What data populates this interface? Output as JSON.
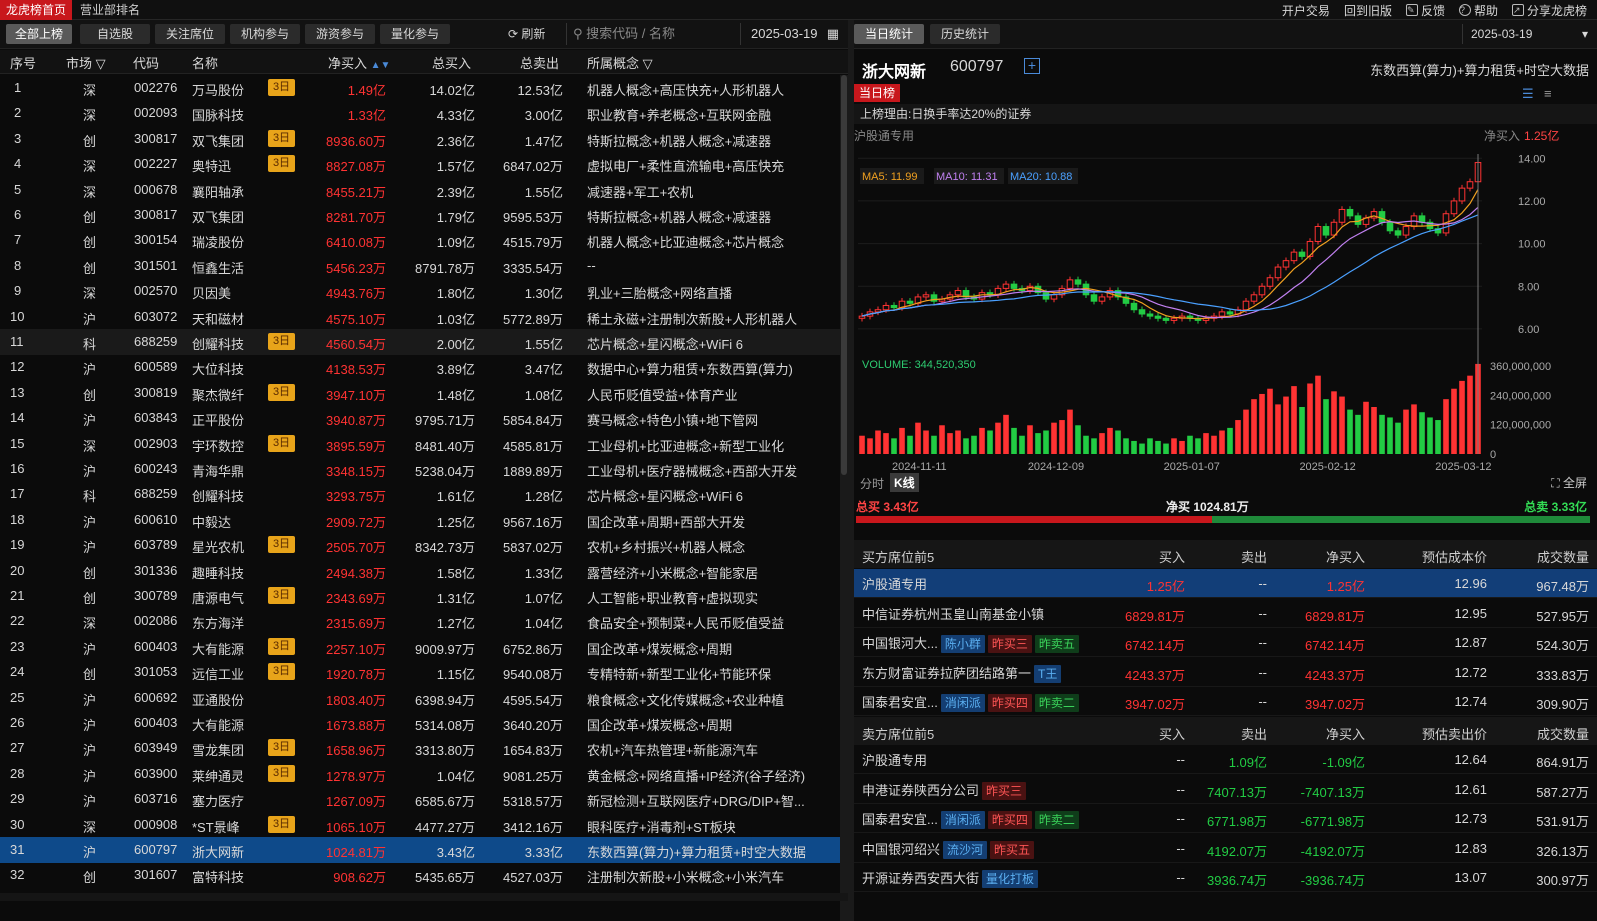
{
  "top": {
    "tabs": [
      "龙虎榜首页",
      "营业部排名"
    ],
    "links": [
      "开户交易",
      "回到旧版",
      "反馈",
      "帮助",
      "分享龙虎榜"
    ]
  },
  "filters": {
    "buttons": [
      "全部上榜",
      "自选股",
      "关注席位",
      "机构参与",
      "游资参与",
      "量化参与"
    ],
    "refresh": "刷新",
    "search_placeholder": "搜索代码 / 名称",
    "date": "2025-03-19"
  },
  "table": {
    "headers": [
      "序号",
      "市场",
      "代码",
      "名称",
      "净买入",
      "总买入",
      "总卖出",
      "所属概念"
    ],
    "rows": [
      {
        "n": "1",
        "m": "深",
        "code": "002276",
        "name": "万马股份",
        "tag": "3日",
        "net": "1.49亿",
        "buy": "14.02亿",
        "sell": "12.53亿",
        "concept": "机器人概念+高压快充+人形机器人"
      },
      {
        "n": "2",
        "m": "深",
        "code": "002093",
        "name": "国脉科技",
        "tag": "",
        "net": "1.33亿",
        "buy": "4.33亿",
        "sell": "3.00亿",
        "concept": "职业教育+养老概念+互联网金融"
      },
      {
        "n": "3",
        "m": "创",
        "code": "300817",
        "name": "双飞集团",
        "tag": "3日",
        "net": "8936.60万",
        "buy": "2.36亿",
        "sell": "1.47亿",
        "concept": "特斯拉概念+机器人概念+减速器"
      },
      {
        "n": "4",
        "m": "深",
        "code": "002227",
        "name": "奥特迅",
        "tag": "3日",
        "net": "8827.08万",
        "buy": "1.57亿",
        "sell": "6847.02万",
        "concept": "虚拟电厂+柔性直流输电+高压快充"
      },
      {
        "n": "5",
        "m": "深",
        "code": "000678",
        "name": "襄阳轴承",
        "tag": "",
        "net": "8455.21万",
        "buy": "2.39亿",
        "sell": "1.55亿",
        "concept": "减速器+军工+农机"
      },
      {
        "n": "6",
        "m": "创",
        "code": "300817",
        "name": "双飞集团",
        "tag": "",
        "net": "8281.70万",
        "buy": "1.79亿",
        "sell": "9595.53万",
        "concept": "特斯拉概念+机器人概念+减速器"
      },
      {
        "n": "7",
        "m": "创",
        "code": "300154",
        "name": "瑞凌股份",
        "tag": "",
        "net": "6410.08万",
        "buy": "1.09亿",
        "sell": "4515.79万",
        "concept": "机器人概念+比亚迪概念+芯片概念"
      },
      {
        "n": "8",
        "m": "创",
        "code": "301501",
        "name": "恒鑫生活",
        "tag": "",
        "net": "5456.23万",
        "buy": "8791.78万",
        "sell": "3335.54万",
        "concept": "--"
      },
      {
        "n": "9",
        "m": "深",
        "code": "002570",
        "name": "贝因美",
        "tag": "",
        "net": "4943.76万",
        "buy": "1.80亿",
        "sell": "1.30亿",
        "concept": "乳业+三胎概念+网络直播"
      },
      {
        "n": "10",
        "m": "沪",
        "code": "603072",
        "name": "天和磁材",
        "tag": "",
        "net": "4575.10万",
        "buy": "1.03亿",
        "sell": "5772.89万",
        "concept": "稀土永磁+注册制次新股+人形机器人"
      },
      {
        "n": "11",
        "m": "科",
        "code": "688259",
        "name": "创耀科技",
        "tag": "3日",
        "net": "4560.54万",
        "buy": "2.00亿",
        "sell": "1.55亿",
        "concept": "芯片概念+星闪概念+WiFi 6"
      },
      {
        "n": "12",
        "m": "沪",
        "code": "600589",
        "name": "大位科技",
        "tag": "",
        "net": "4138.53万",
        "buy": "3.89亿",
        "sell": "3.47亿",
        "concept": "数据中心+算力租赁+东数西算(算力)"
      },
      {
        "n": "13",
        "m": "创",
        "code": "300819",
        "name": "聚杰微纤",
        "tag": "3日",
        "net": "3947.10万",
        "buy": "1.48亿",
        "sell": "1.08亿",
        "concept": "人民币贬值受益+体育产业"
      },
      {
        "n": "14",
        "m": "沪",
        "code": "603843",
        "name": "正平股份",
        "tag": "",
        "net": "3940.87万",
        "buy": "9795.71万",
        "sell": "5854.84万",
        "concept": "赛马概念+特色小镇+地下管网"
      },
      {
        "n": "15",
        "m": "深",
        "code": "002903",
        "name": "宇环数控",
        "tag": "3日",
        "net": "3895.59万",
        "buy": "8481.40万",
        "sell": "4585.81万",
        "concept": "工业母机+比亚迪概念+新型工业化"
      },
      {
        "n": "16",
        "m": "沪",
        "code": "600243",
        "name": "青海华鼎",
        "tag": "",
        "net": "3348.15万",
        "buy": "5238.04万",
        "sell": "1889.89万",
        "concept": "工业母机+医疗器械概念+西部大开发"
      },
      {
        "n": "17",
        "m": "科",
        "code": "688259",
        "name": "创耀科技",
        "tag": "",
        "net": "3293.75万",
        "buy": "1.61亿",
        "sell": "1.28亿",
        "concept": "芯片概念+星闪概念+WiFi 6"
      },
      {
        "n": "18",
        "m": "沪",
        "code": "600610",
        "name": "中毅达",
        "tag": "",
        "net": "2909.72万",
        "buy": "1.25亿",
        "sell": "9567.16万",
        "concept": "国企改革+周期+西部大开发"
      },
      {
        "n": "19",
        "m": "沪",
        "code": "603789",
        "name": "星光农机",
        "tag": "3日",
        "net": "2505.70万",
        "buy": "8342.73万",
        "sell": "5837.02万",
        "concept": "农机+乡村振兴+机器人概念"
      },
      {
        "n": "20",
        "m": "创",
        "code": "301336",
        "name": "趣睡科技",
        "tag": "",
        "net": "2494.38万",
        "buy": "1.58亿",
        "sell": "1.33亿",
        "concept": "露营经济+小米概念+智能家居"
      },
      {
        "n": "21",
        "m": "创",
        "code": "300789",
        "name": "唐源电气",
        "tag": "3日",
        "net": "2343.69万",
        "buy": "1.31亿",
        "sell": "1.07亿",
        "concept": "人工智能+职业教育+虚拟现实"
      },
      {
        "n": "22",
        "m": "深",
        "code": "002086",
        "name": "东方海洋",
        "tag": "",
        "net": "2315.69万",
        "buy": "1.27亿",
        "sell": "1.04亿",
        "concept": "食品安全+预制菜+人民币贬值受益"
      },
      {
        "n": "23",
        "m": "沪",
        "code": "600403",
        "name": "大有能源",
        "tag": "3日",
        "net": "2257.10万",
        "buy": "9009.97万",
        "sell": "6752.86万",
        "concept": "国企改革+煤炭概念+周期"
      },
      {
        "n": "24",
        "m": "创",
        "code": "301053",
        "name": "远信工业",
        "tag": "3日",
        "net": "1920.78万",
        "buy": "1.15亿",
        "sell": "9540.08万",
        "concept": "专精特新+新型工业化+节能环保"
      },
      {
        "n": "25",
        "m": "沪",
        "code": "600692",
        "name": "亚通股份",
        "tag": "",
        "net": "1803.40万",
        "buy": "6398.94万",
        "sell": "4595.54万",
        "concept": "粮食概念+文化传媒概念+农业种植"
      },
      {
        "n": "26",
        "m": "沪",
        "code": "600403",
        "name": "大有能源",
        "tag": "",
        "net": "1673.88万",
        "buy": "5314.08万",
        "sell": "3640.20万",
        "concept": "国企改革+煤炭概念+周期"
      },
      {
        "n": "27",
        "m": "沪",
        "code": "603949",
        "name": "雪龙集团",
        "tag": "3日",
        "net": "1658.96万",
        "buy": "3313.80万",
        "sell": "1654.83万",
        "concept": "农机+汽车热管理+新能源汽车"
      },
      {
        "n": "28",
        "m": "沪",
        "code": "603900",
        "name": "莱绅通灵",
        "tag": "3日",
        "net": "1278.97万",
        "buy": "1.04亿",
        "sell": "9081.25万",
        "concept": "黄金概念+网络直播+IP经济(谷子经济)"
      },
      {
        "n": "29",
        "m": "沪",
        "code": "603716",
        "name": "塞力医疗",
        "tag": "",
        "net": "1267.09万",
        "buy": "6585.67万",
        "sell": "5318.57万",
        "concept": "新冠检测+互联网医疗+DRG/DIP+智..."
      },
      {
        "n": "30",
        "m": "深",
        "code": "000908",
        "name": "*ST景峰",
        "tag": "3日",
        "net": "1065.10万",
        "buy": "4477.27万",
        "sell": "3412.16万",
        "concept": "眼科医疗+消毒剂+ST板块"
      },
      {
        "n": "31",
        "m": "沪",
        "code": "600797",
        "name": "浙大网新",
        "tag": "",
        "net": "1024.81万",
        "buy": "3.43亿",
        "sell": "3.33亿",
        "concept": "东数西算(算力)+算力租赁+时空大数据"
      },
      {
        "n": "32",
        "m": "创",
        "code": "301607",
        "name": "富特科技",
        "tag": "",
        "net": "908.62万",
        "buy": "5435.65万",
        "sell": "4527.03万",
        "concept": "注册制次新股+小米概念+小米汽车"
      }
    ]
  },
  "right": {
    "tabs": [
      "当日统计",
      "历史统计"
    ],
    "date": "2025-03-19",
    "stock_name": "浙大网新",
    "stock_code": "600797",
    "concepts": "东数西算(算力)+算力租赁+时空大数据",
    "day_tag": "当日榜",
    "reason": "上榜理由:日换手率达20%的证券",
    "channel": "沪股通专用",
    "channel_net_label": "净买入",
    "channel_net": "1.25亿",
    "ma": [
      "MA5: 11.99",
      "MA10: 11.31",
      "MA20: 10.88"
    ],
    "volume_label": "VOLUME: 344,520,350",
    "chart_tabs": [
      "分时",
      "K线"
    ],
    "fullscreen": "全屏",
    "total_buy": "总买 3.43亿",
    "net_buy": "净买 1024.81万",
    "total_sell": "总卖 3.33亿",
    "buy_header": [
      "买方席位前5",
      "买入",
      "卖出",
      "净买入",
      "预估成本价",
      "成交数量"
    ],
    "buy_rows": [
      {
        "name": "沪股通专用",
        "badges": [],
        "buy": "1.25亿",
        "sell": "--",
        "net": "1.25亿",
        "price": "12.96",
        "qty": "967.48万"
      },
      {
        "name": "中信证券杭州玉皇山南基金小镇",
        "badges": [],
        "buy": "6829.81万",
        "sell": "--",
        "net": "6829.81万",
        "price": "12.95",
        "qty": "527.95万"
      },
      {
        "name": "中国银河大...",
        "badges": [
          {
            "t": "陈小群",
            "c": "b-blue"
          },
          {
            "t": "昨买三",
            "c": "b-red"
          },
          {
            "t": "昨卖五",
            "c": "b-grn"
          }
        ],
        "buy": "6742.14万",
        "sell": "--",
        "net": "6742.14万",
        "price": "12.87",
        "qty": "524.30万"
      },
      {
        "name": "东方财富证券拉萨团结路第一",
        "badges": [
          {
            "t": "T王",
            "c": "b-blue"
          }
        ],
        "buy": "4243.37万",
        "sell": "--",
        "net": "4243.37万",
        "price": "12.72",
        "qty": "333.83万"
      },
      {
        "name": "国泰君安宜...",
        "badges": [
          {
            "t": "消闲派",
            "c": "b-blue"
          },
          {
            "t": "昨买四",
            "c": "b-red"
          },
          {
            "t": "昨卖二",
            "c": "b-grn"
          }
        ],
        "buy": "3947.02万",
        "sell": "--",
        "net": "3947.02万",
        "price": "12.74",
        "qty": "309.90万"
      }
    ],
    "sell_header": [
      "卖方席位前5",
      "买入",
      "卖出",
      "净买入",
      "预估卖出价",
      "成交数量"
    ],
    "sell_rows": [
      {
        "name": "沪股通专用",
        "badges": [],
        "buy": "--",
        "sell": "1.09亿",
        "net": "-1.09亿",
        "price": "12.64",
        "qty": "864.91万"
      },
      {
        "name": "申港证券陕西分公司",
        "badges": [
          {
            "t": "昨买三",
            "c": "b-red"
          }
        ],
        "buy": "--",
        "sell": "7407.13万",
        "net": "-7407.13万",
        "price": "12.61",
        "qty": "587.27万"
      },
      {
        "name": "国泰君安宜...",
        "badges": [
          {
            "t": "消闲派",
            "c": "b-blue"
          },
          {
            "t": "昨买四",
            "c": "b-red"
          },
          {
            "t": "昨卖二",
            "c": "b-grn"
          }
        ],
        "buy": "--",
        "sell": "6771.98万",
        "net": "-6771.98万",
        "price": "12.73",
        "qty": "531.91万"
      },
      {
        "name": "中国银河绍兴",
        "badges": [
          {
            "t": "流沙河",
            "c": "b-blue"
          },
          {
            "t": "昨买五",
            "c": "b-red"
          }
        ],
        "buy": "--",
        "sell": "4192.07万",
        "net": "-4192.07万",
        "price": "12.83",
        "qty": "326.13万"
      },
      {
        "name": "开源证券西安西大街",
        "badges": [
          {
            "t": "量化打板",
            "c": "b-blue"
          }
        ],
        "buy": "--",
        "sell": "3936.74万",
        "net": "-3936.74万",
        "price": "13.07",
        "qty": "300.97万"
      }
    ]
  },
  "chart_data": {
    "type": "candlestick",
    "x_ticks": [
      "2024-11-11",
      "2024-12-09",
      "2025-01-07",
      "2025-02-12",
      "2025-03-12"
    ],
    "y_ticks": [
      6.0,
      8.0,
      10.0,
      12.0,
      14.0
    ],
    "ylim": [
      5.2,
      14.2
    ],
    "volume_ticks": [
      "360,000,000",
      "240,000,000",
      "120,000,000",
      "0"
    ],
    "volume_ylim": [
      0,
      360000000
    ],
    "close": [
      6.6,
      6.8,
      6.9,
      7.1,
      7.0,
      7.3,
      7.2,
      7.5,
      7.6,
      7.3,
      7.4,
      7.6,
      7.8,
      7.5,
      7.4,
      7.7,
      7.6,
      7.9,
      8.1,
      7.9,
      7.8,
      8.0,
      7.7,
      7.4,
      7.6,
      7.9,
      8.3,
      8.1,
      7.6,
      7.3,
      7.5,
      7.8,
      7.5,
      7.2,
      6.9,
      6.7,
      6.6,
      6.5,
      6.4,
      6.5,
      6.6,
      6.5,
      6.4,
      6.5,
      6.6,
      6.8,
      6.7,
      6.9,
      7.3,
      7.6,
      8.0,
      8.4,
      8.9,
      9.2,
      9.6,
      9.4,
      10.1,
      10.8,
      10.4,
      11.0,
      11.6,
      11.3,
      10.9,
      11.2,
      11.5,
      11.0,
      10.6,
      10.4,
      10.8,
      11.3,
      11.0,
      10.7,
      10.5,
      11.4,
      12.0,
      12.6,
      12.9,
      13.8
    ],
    "volume": [
      70,
      60,
      90,
      80,
      60,
      100,
      70,
      120,
      90,
      70,
      110,
      80,
      90,
      60,
      70,
      100,
      90,
      120,
      150,
      100,
      70,
      110,
      80,
      90,
      120,
      130,
      170,
      110,
      70,
      60,
      80,
      100,
      90,
      60,
      50,
      40,
      60,
      50,
      40,
      60,
      50,
      70,
      60,
      80,
      70,
      90,
      100,
      130,
      170,
      210,
      230,
      250,
      190,
      220,
      260,
      180,
      270,
      300,
      210,
      240,
      220,
      170,
      150,
      200,
      180,
      150,
      140,
      120,
      170,
      190,
      160,
      140,
      130,
      210,
      250,
      280,
      300,
      345
    ],
    "ma_names": [
      "MA5",
      "MA10",
      "MA20"
    ]
  }
}
